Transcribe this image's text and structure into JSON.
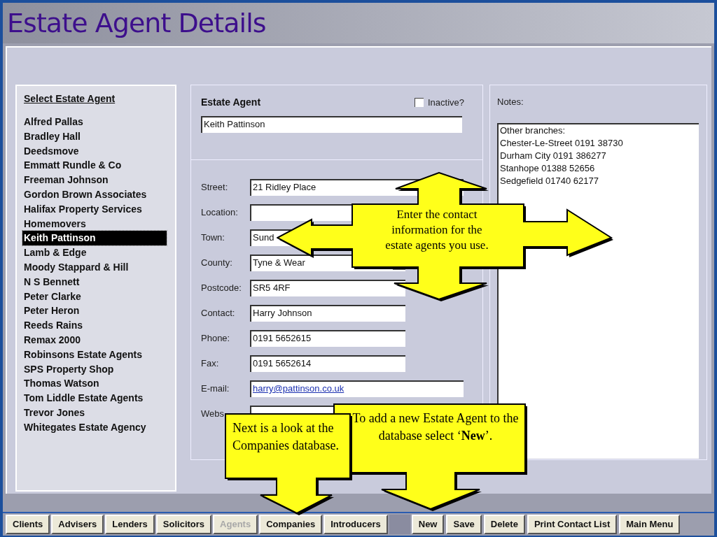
{
  "window": {
    "title": "Estate Agent Details"
  },
  "agent_list": {
    "heading": "Select Estate Agent",
    "items": [
      {
        "label": "Alfred Pallas",
        "selected": false
      },
      {
        "label": "Bradley Hall",
        "selected": false
      },
      {
        "label": "Deedsmove",
        "selected": false
      },
      {
        "label": "Emmatt Rundle & Co",
        "selected": false
      },
      {
        "label": "Freeman Johnson",
        "selected": false
      },
      {
        "label": "Gordon Brown Associates",
        "selected": false
      },
      {
        "label": "Halifax Property Services",
        "selected": false
      },
      {
        "label": "Homemovers",
        "selected": false
      },
      {
        "label": "Keith Pattinson",
        "selected": true
      },
      {
        "label": "Lamb & Edge",
        "selected": false
      },
      {
        "label": "Moody Stappard & Hill",
        "selected": false
      },
      {
        "label": "N S Bennett",
        "selected": false
      },
      {
        "label": "Peter Clarke",
        "selected": false
      },
      {
        "label": "Peter Heron",
        "selected": false
      },
      {
        "label": "Reeds Rains",
        "selected": false
      },
      {
        "label": "Remax 2000",
        "selected": false
      },
      {
        "label": "Robinsons Estate Agents",
        "selected": false
      },
      {
        "label": "SPS Property Shop",
        "selected": false
      },
      {
        "label": "Thomas Watson",
        "selected": false
      },
      {
        "label": "Tom Liddle Estate Agents",
        "selected": false
      },
      {
        "label": "Trevor Jones",
        "selected": false
      },
      {
        "label": "Whitegates Estate Agency",
        "selected": false
      }
    ]
  },
  "agent_form": {
    "heading": "Estate Agent",
    "inactive": {
      "label": "Inactive?",
      "checked": false
    },
    "name": "Keith Pattinson",
    "fields": [
      {
        "kind": "text",
        "label": "Street:",
        "value": "21 Ridley Place"
      },
      {
        "kind": "text",
        "label": "Location:"
      },
      {
        "kind": "text",
        "label": "Town:",
        "value": "Sund"
      },
      {
        "kind": "dropdown",
        "label": "County:",
        "value": "Tyne & Wear"
      },
      {
        "kind": "text",
        "label": "Postcode:",
        "value": "SR5 4RF"
      },
      {
        "kind": "text",
        "label": "Contact:",
        "value": "Harry Johnson"
      },
      {
        "kind": "text",
        "label": "Phone:",
        "value": "0191 5652615"
      },
      {
        "kind": "text",
        "label": "Fax:",
        "value": "0191 5652614"
      },
      {
        "kind": "link",
        "label": "E-mail:",
        "value": "harry@pattinson.co.uk"
      },
      {
        "kind": "text",
        "label": "Webs"
      }
    ]
  },
  "notes": {
    "label": "Notes:",
    "lines": [
      "Other branches:",
      "Chester-Le-Street 0191 38730",
      "Durham City 0191 386277",
      "Stanhope 01388 52656",
      "Sedgefield 01740 62177"
    ]
  },
  "toolbar": {
    "nav": [
      {
        "label": "Clients",
        "disabled": false
      },
      {
        "label": "Advisers",
        "disabled": false
      },
      {
        "label": "Lenders",
        "disabled": false
      },
      {
        "label": "Solicitors",
        "disabled": false
      },
      {
        "label": "Agents",
        "disabled": true
      },
      {
        "label": "Companies",
        "disabled": false
      },
      {
        "label": "Introducers",
        "disabled": false
      }
    ],
    "actions": [
      {
        "label": "New",
        "disabled": false
      },
      {
        "label": "Save",
        "disabled": false
      },
      {
        "label": "Delete",
        "disabled": false
      },
      {
        "label": "Print Contact List",
        "disabled": false
      },
      {
        "label": "Main Menu",
        "disabled": false
      }
    ]
  },
  "callouts": [
    {
      "kind": "cross",
      "text": "Enter the contact information for the estate agents you use."
    },
    {
      "kind": "down_right",
      "text": "To add a new Estate Agent to the database select ‘**New**’."
    },
    {
      "kind": "down_left",
      "text": "Next is a look at the Companies database."
    }
  ]
}
